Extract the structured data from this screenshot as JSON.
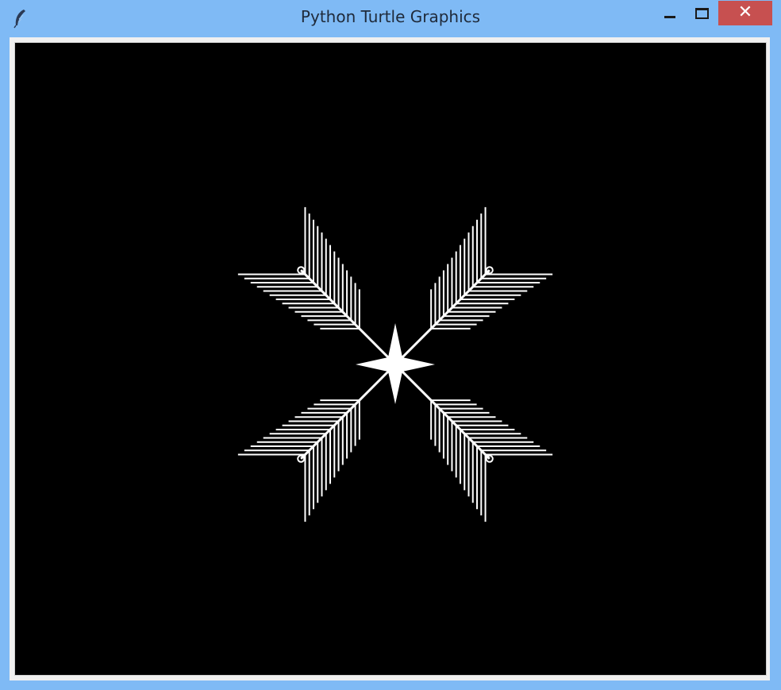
{
  "window": {
    "title": "Python Turtle Graphics",
    "close_glyph": "✕"
  },
  "icons": {
    "app": "feather-icon",
    "minimize": "minimize-icon",
    "maximize": "maximize-icon",
    "close": "close-icon"
  },
  "colors": {
    "titlebar": "#7fbaf5",
    "canvas_bg": "#000000",
    "pen": "#ffffff",
    "close_button": "#c75050"
  }
}
